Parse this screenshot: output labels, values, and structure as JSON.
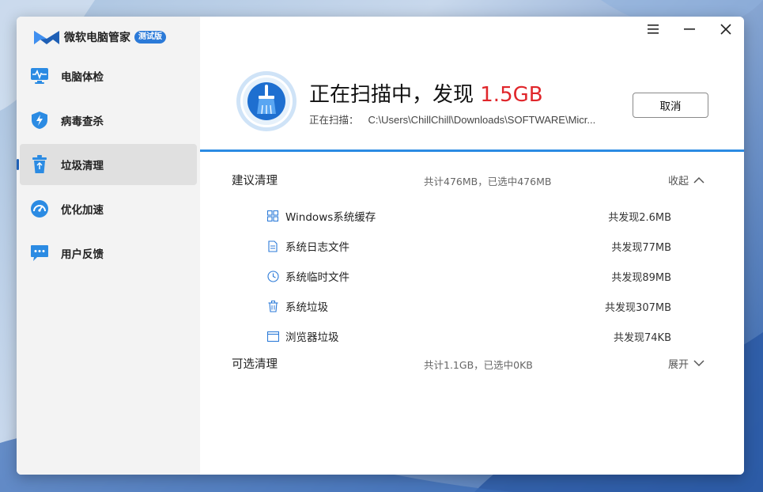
{
  "app": {
    "name": "微软电脑管家",
    "badge": "测试版"
  },
  "sidebar": {
    "items": [
      {
        "label": "电脑体检",
        "icon": "monitor-pulse-icon"
      },
      {
        "label": "病毒查杀",
        "icon": "shield-bolt-icon"
      },
      {
        "label": "垃圾清理",
        "icon": "recycle-bin-icon",
        "active": true
      },
      {
        "label": "优化加速",
        "icon": "speedometer-icon"
      },
      {
        "label": "用户反馈",
        "icon": "chat-bubble-icon"
      }
    ]
  },
  "window_controls": {
    "menu": "menu-icon",
    "minimize": "minimize-icon",
    "close": "close-icon"
  },
  "scan": {
    "title_prefix": "正在扫描中，发现 ",
    "found_size": "1.5GB",
    "status_label": "正在扫描：",
    "current_path": "C:\\Users\\ChillChill\\Downloads\\SOFTWARE\\Micr...",
    "cancel_label": "取消",
    "progress_percent": 100
  },
  "sections": [
    {
      "title": "建议清理",
      "summary": "共计476MB，已选中476MB",
      "toggle_label": "收起",
      "expanded": true,
      "items": [
        {
          "label": "Windows系统缓存",
          "value": "共发现2.6MB",
          "icon": "windows-logo-icon"
        },
        {
          "label": "系统日志文件",
          "value": "共发现77MB",
          "icon": "document-icon"
        },
        {
          "label": "系统临时文件",
          "value": "共发现89MB",
          "icon": "clock-icon"
        },
        {
          "label": "系统垃圾",
          "value": "共发现307MB",
          "icon": "trash-icon"
        },
        {
          "label": "浏览器垃圾",
          "value": "共发现74KB",
          "icon": "browser-window-icon"
        }
      ]
    },
    {
      "title": "可选清理",
      "summary": "共计1.1GB，已选中0KB",
      "toggle_label": "展开",
      "expanded": false
    }
  ],
  "colors": {
    "accent": "#2b8be3",
    "highlight": "#e0262b",
    "sidebar_bg": "#f3f3f3",
    "active_item_bg": "#e0e0e0"
  }
}
